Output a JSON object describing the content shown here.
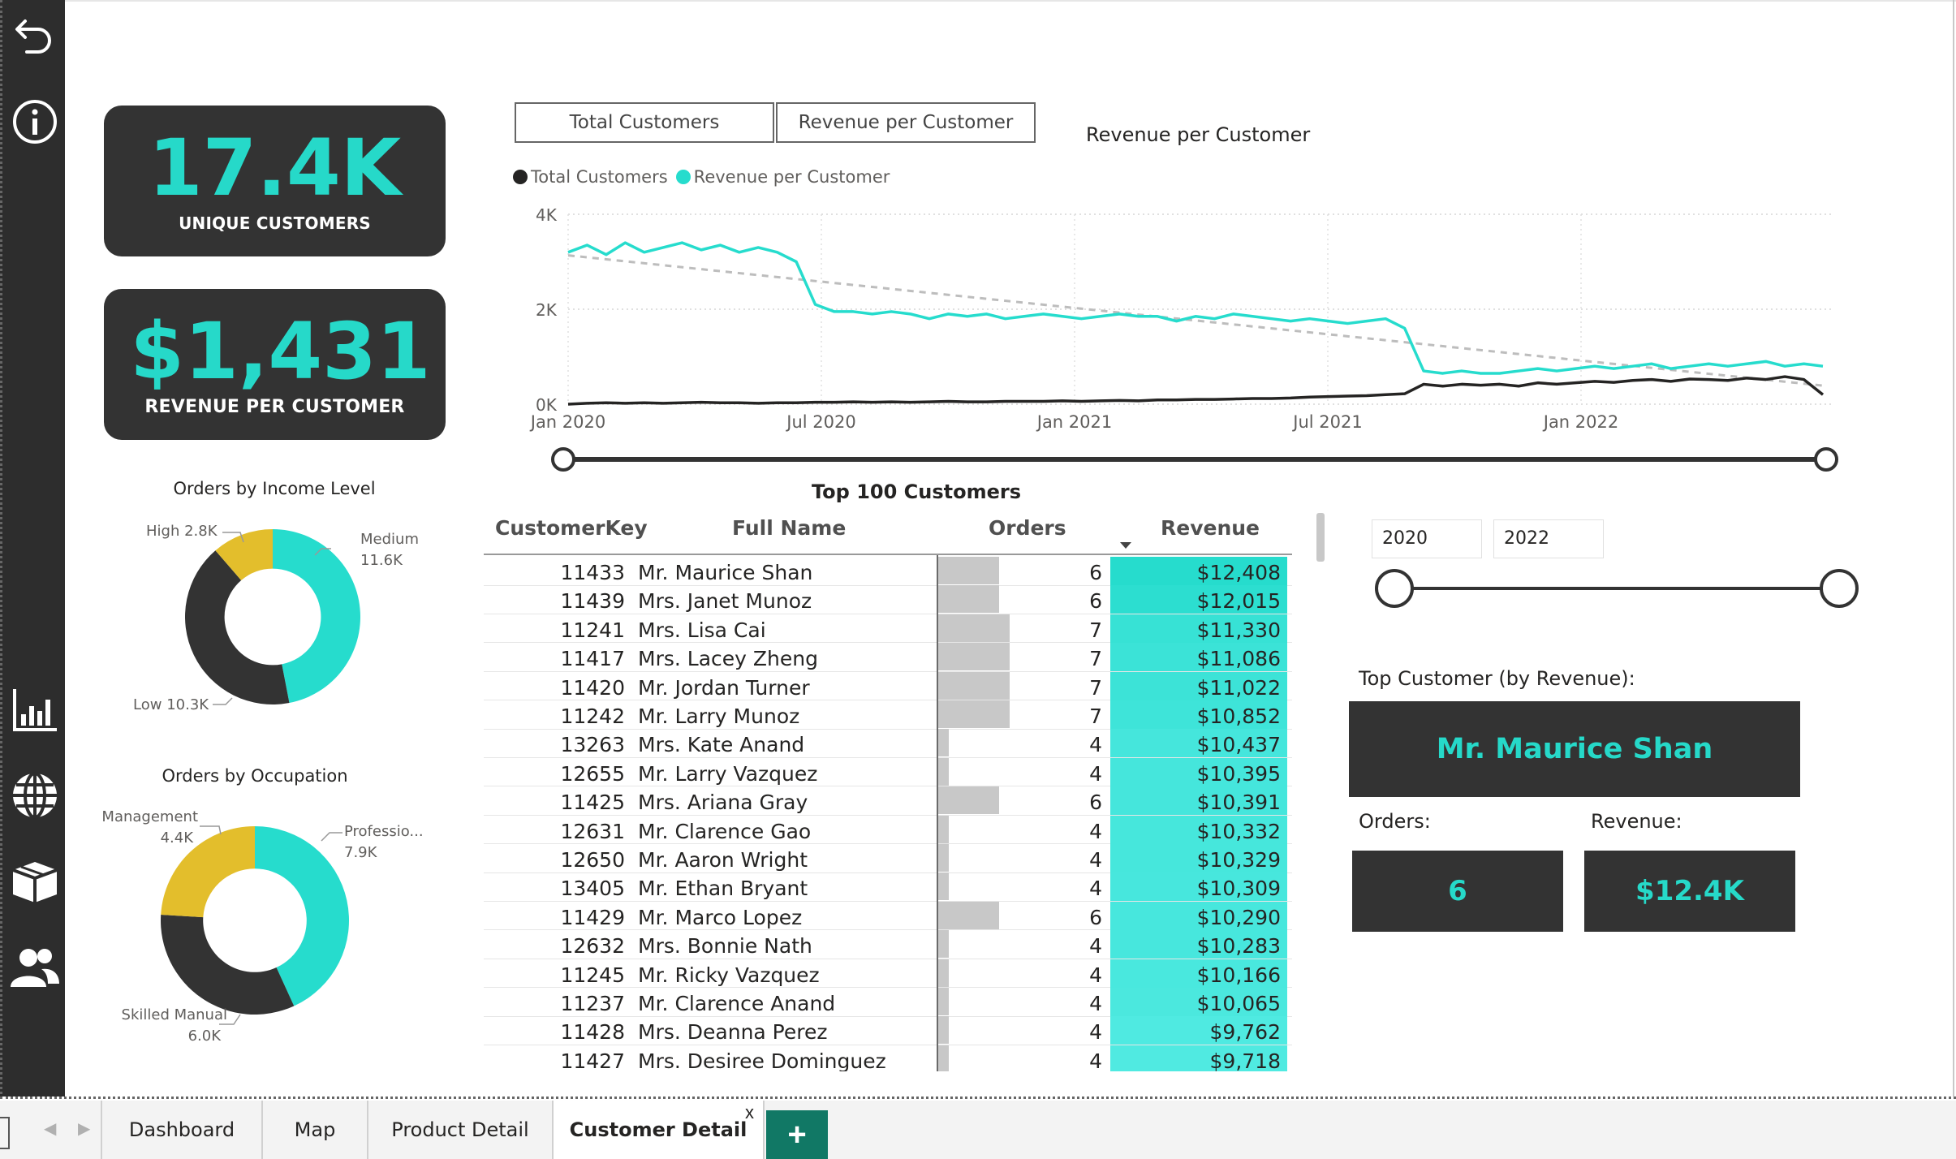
{
  "kpis": {
    "unique_customers_value": "17.4K",
    "unique_customers_label": "UNIQUE CUSTOMERS",
    "revenue_per_customer_value": "$1,431",
    "revenue_per_customer_label": "REVENUE PER CUSTOMER"
  },
  "income_chart": {
    "title": "Orders by Income Level",
    "slices": [
      {
        "name": "High",
        "value_label": "2.8K",
        "value": 2.8,
        "color": "#e3be2c"
      },
      {
        "name": "Medium",
        "value_label": "11.6K",
        "value": 11.6,
        "color": "#26dccd"
      },
      {
        "name": "Low",
        "value_label": "10.3K",
        "value": 10.3,
        "color": "#333333"
      }
    ]
  },
  "occupation_chart": {
    "title": "Orders by Occupation",
    "slices": [
      {
        "name": "Management",
        "value_label": "4.4K",
        "value": 4.4,
        "color": "#e3be2c"
      },
      {
        "name": "Professio...",
        "value_label": "7.9K",
        "value": 7.9,
        "color": "#26dccd"
      },
      {
        "name": "Skilled Manual",
        "value_label": "6.0K",
        "value": 6.0,
        "color": "#333333"
      }
    ]
  },
  "toggle_buttons": [
    "Total Customers",
    "Revenue per Customer"
  ],
  "line_chart": {
    "title": "Revenue per Customer",
    "legend": [
      "Total Customers",
      "Revenue per Customer"
    ],
    "series_colors": [
      "#252423",
      "#26dccd"
    ],
    "y_ticks": [
      "4K",
      "2K",
      "0K"
    ],
    "x_ticks": [
      "Jan 2020",
      "Jul 2020",
      "Jan 2021",
      "Jul 2021",
      "Jan 2022"
    ],
    "ylim": [
      0,
      4000
    ]
  },
  "chart_data": {
    "type": "line",
    "x_start": "2020-01",
    "x_end": "2022-06",
    "ylim": [
      0,
      4000
    ],
    "series": [
      {
        "name": "Revenue per Customer",
        "values": [
          3200,
          3350,
          3150,
          3400,
          3200,
          3300,
          3400,
          3250,
          3350,
          3200,
          3300,
          3200,
          3000,
          2100,
          1950,
          1950,
          1900,
          1950,
          1900,
          1800,
          1900,
          1850,
          1900,
          1800,
          1850,
          1900,
          1850,
          1800,
          1850,
          1900,
          1850,
          1850,
          1750,
          1850,
          1800,
          1900,
          1850,
          1800,
          1750,
          1800,
          1750,
          1700,
          1750,
          1800,
          1600,
          700,
          650,
          700,
          650,
          650,
          700,
          750,
          700,
          750,
          800,
          750,
          800,
          850,
          750,
          800,
          850,
          800,
          850,
          900,
          800,
          850,
          800
        ]
      },
      {
        "name": "Total Customers",
        "values": [
          0,
          20,
          30,
          20,
          30,
          20,
          30,
          40,
          30,
          30,
          20,
          30,
          30,
          40,
          40,
          50,
          40,
          50,
          40,
          50,
          60,
          50,
          50,
          60,
          60,
          60,
          70,
          60,
          70,
          80,
          70,
          90,
          90,
          100,
          100,
          110,
          120,
          120,
          130,
          150,
          160,
          170,
          180,
          200,
          220,
          420,
          380,
          420,
          400,
          420,
          380,
          450,
          420,
          450,
          480,
          460,
          500,
          520,
          480,
          530,
          520,
          500,
          550,
          520,
          580,
          520,
          200
        ]
      }
    ]
  },
  "table": {
    "title": "Top 100 Customers",
    "headers": [
      "CustomerKey",
      "Full Name",
      "Orders",
      "Revenue"
    ],
    "rows": [
      [
        "11433",
        "Mr. Maurice Shan",
        "6",
        "$12,408"
      ],
      [
        "11439",
        "Mrs. Janet Munoz",
        "6",
        "$12,015"
      ],
      [
        "11241",
        "Mrs. Lisa Cai",
        "7",
        "$11,330"
      ],
      [
        "11417",
        "Mrs. Lacey Zheng",
        "7",
        "$11,086"
      ],
      [
        "11420",
        "Mr. Jordan Turner",
        "7",
        "$11,022"
      ],
      [
        "11242",
        "Mr. Larry Munoz",
        "7",
        "$10,852"
      ],
      [
        "13263",
        "Mrs. Kate Anand",
        "4",
        "$10,437"
      ],
      [
        "12655",
        "Mr. Larry Vazquez",
        "4",
        "$10,395"
      ],
      [
        "11425",
        "Mrs. Ariana Gray",
        "6",
        "$10,391"
      ],
      [
        "12631",
        "Mr. Clarence Gao",
        "4",
        "$10,332"
      ],
      [
        "12650",
        "Mr. Aaron Wright",
        "4",
        "$10,329"
      ],
      [
        "13405",
        "Mr. Ethan Bryant",
        "4",
        "$10,309"
      ],
      [
        "11429",
        "Mr. Marco Lopez",
        "6",
        "$10,290"
      ],
      [
        "12632",
        "Mrs. Bonnie Nath",
        "4",
        "$10,283"
      ],
      [
        "11245",
        "Mr. Ricky Vazquez",
        "4",
        "$10,166"
      ],
      [
        "11237",
        "Mr. Clarence Anand",
        "4",
        "$10,065"
      ],
      [
        "11428",
        "Mrs. Deanna Perez",
        "4",
        "$9,762"
      ],
      [
        "11427",
        "Mrs. Desiree Dominguez",
        "4",
        "$9,718"
      ]
    ]
  },
  "year_slicer": {
    "start": "2020",
    "end": "2022"
  },
  "top_customer": {
    "label": "Top Customer (by Revenue):",
    "name": "Mr. Maurice Shan",
    "orders_label": "Orders:",
    "orders_value": "6",
    "revenue_label": "Revenue:",
    "revenue_value": "$12.4K"
  },
  "tabs": [
    "Dashboard",
    "Map",
    "Product Detail",
    "Customer Detail"
  ],
  "active_tab": "Customer Detail",
  "tab_close": "x",
  "add_tab": "+",
  "nav_icons": [
    "back-arrow-icon",
    "info-icon",
    "bar-chart-icon",
    "globe-icon",
    "box-icon",
    "users-icon"
  ],
  "colors": {
    "accent": "#26dccd",
    "dark": "#333333",
    "gold": "#e3be2c",
    "tab_green": "#117865"
  }
}
